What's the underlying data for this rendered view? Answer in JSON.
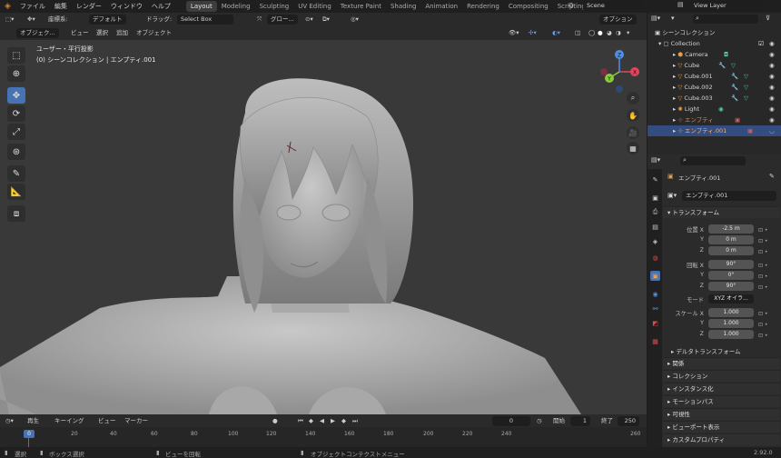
{
  "menubar": {
    "items": [
      "ファイル",
      "編集",
      "レンダー",
      "ウィンドウ",
      "ヘルプ"
    ],
    "workspaces": [
      "Layout",
      "Modeling",
      "Sculpting",
      "UV Editing",
      "Texture Paint",
      "Shading",
      "Animation",
      "Rendering",
      "Compositing",
      "Scripting"
    ],
    "active_workspace": "Layout",
    "scene": "Scene",
    "view_layer": "View Layer"
  },
  "viewport_header": {
    "coord_label": "座標系:",
    "coord_value": "デフォルト",
    "drag_label": "ドラッグ:",
    "drag_value": "Select Box",
    "orientation": "グロー...",
    "options": "オプション",
    "mode": "オブジェク...",
    "menus": [
      "ビュー",
      "選択",
      "追加",
      "オブジェクト"
    ]
  },
  "viewport": {
    "view_name": "ユーザー・平行投影",
    "collection_info": "(0) シーンコレクション | エンプティ.001",
    "gizmo": {
      "x": "X",
      "y": "Y",
      "z": "Z"
    }
  },
  "outliner": {
    "root": "シーンコレクション",
    "collection": "Collection",
    "items": [
      {
        "name": "Camera"
      },
      {
        "name": "Cube"
      },
      {
        "name": "Cube.001"
      },
      {
        "name": "Cube.002"
      },
      {
        "name": "Cube.003"
      },
      {
        "name": "Light"
      },
      {
        "name": "エンプティ"
      },
      {
        "name": "エンプティ.001"
      }
    ]
  },
  "properties": {
    "object_name": "エンプティ.001",
    "data_name": "エンプティ.001",
    "transform_header": "トランスフォーム",
    "location": {
      "label": "位置 X",
      "x": "-2.5 m",
      "y": "0 m",
      "z": "0 m"
    },
    "rotation": {
      "label": "回転 X",
      "x": "90°",
      "y": "0°",
      "z": "90°"
    },
    "mode_label": "モード",
    "mode_value": "XYZ オイラ...",
    "scale": {
      "label": "スケール X",
      "x": "1.000",
      "y": "1.000",
      "z": "1.000"
    },
    "axis_y": "Y",
    "axis_z": "Z",
    "sections": [
      "デルタトランスフォーム",
      "関係",
      "コレクション",
      "インスタンス化",
      "モーションパス",
      "可視性",
      "ビューポート表示",
      "カスタムプロパティ"
    ]
  },
  "timeline": {
    "playback": "再生",
    "keying": "キーイング",
    "view": "ビュー",
    "marker": "マーカー",
    "current_frame": "0",
    "start_label": "開始",
    "start": "1",
    "end_label": "終了",
    "end": "250",
    "ruler": [
      "0",
      "20",
      "40",
      "60",
      "80",
      "100",
      "120",
      "140",
      "160",
      "180",
      "200",
      "220",
      "240",
      "260"
    ]
  },
  "statusbar": {
    "items": [
      "選択",
      "ボックス選択",
      "ビューを回転",
      "オブジェクトコンテクストメニュー"
    ],
    "version": "2.92.0"
  },
  "colors": {
    "accent": "#4772b3",
    "header": "#2a2a2a",
    "viewport_bg": "#393939",
    "selected_row": "#334d80"
  }
}
